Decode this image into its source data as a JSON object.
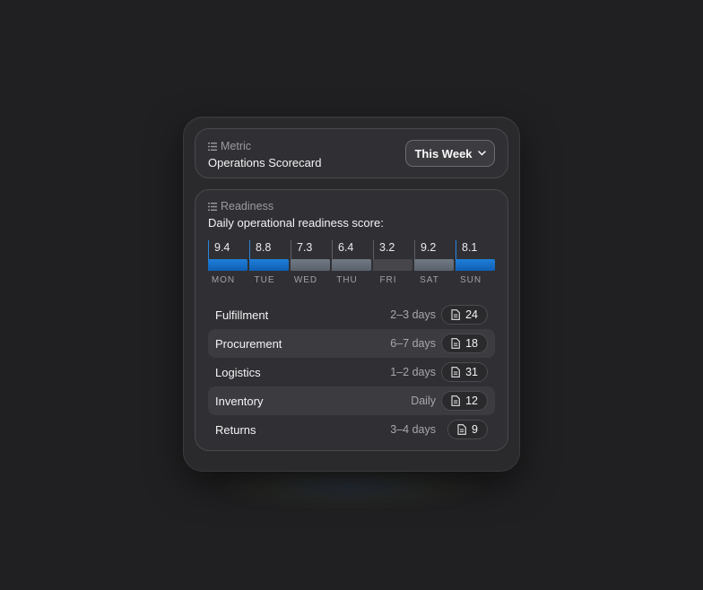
{
  "metric": {
    "eyebrow": "Metric",
    "title": "Operations Scorecard",
    "period_label": "This Week"
  },
  "readiness": {
    "eyebrow": "Readiness",
    "subtitle": "Daily operational readiness score:",
    "days": [
      {
        "label": "MON",
        "value": "9.4",
        "tier": "high"
      },
      {
        "label": "TUE",
        "value": "8.8",
        "tier": "high"
      },
      {
        "label": "WED",
        "value": "7.3",
        "tier": "mid"
      },
      {
        "label": "THU",
        "value": "6.4",
        "tier": "mid"
      },
      {
        "label": "FRI",
        "value": "3.2",
        "tier": "low"
      },
      {
        "label": "SAT",
        "value": "9.2",
        "tier": "mid"
      },
      {
        "label": "SUN",
        "value": "8.1",
        "tier": "high"
      }
    ],
    "rows": [
      {
        "name": "Fulfillment",
        "duration": "2–3 days",
        "count": "24"
      },
      {
        "name": "Procurement",
        "duration": "6–7 days",
        "count": "18"
      },
      {
        "name": "Logistics",
        "duration": "1–2 days",
        "count": "31"
      },
      {
        "name": "Inventory",
        "duration": "Daily",
        "count": "12"
      },
      {
        "name": "Returns",
        "duration": "3–4 days",
        "count": "9"
      }
    ]
  },
  "colors": {
    "accent": "#1a73d1",
    "muted_bar": "#65707b",
    "low_bar": "#46464b"
  }
}
